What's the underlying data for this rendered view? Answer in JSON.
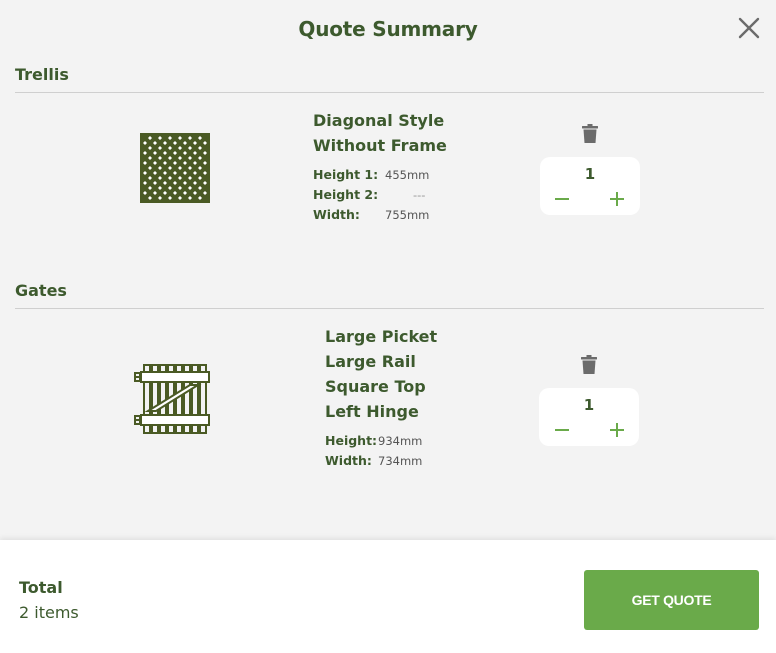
{
  "header": {
    "title": "Quote Summary",
    "close_icon": "close-icon"
  },
  "sections": [
    {
      "heading": "Trellis",
      "item": {
        "icon": "trellis-lattice-icon",
        "name_lines": [
          "Diagonal Style",
          "Without Frame"
        ],
        "specs": [
          {
            "label": "Height 1:",
            "value": "455mm"
          },
          {
            "label": "Height 2:",
            "value": "---"
          },
          {
            "label": "Width:",
            "value": "755mm"
          }
        ],
        "quantity": "1"
      }
    },
    {
      "heading": "Gates",
      "item": {
        "icon": "gate-icon",
        "name_lines": [
          "Large Picket",
          "Large Rail",
          "Square Top",
          "Left Hinge"
        ],
        "specs": [
          {
            "label": "Height:",
            "value": "934mm"
          },
          {
            "label": "Width:",
            "value": "734mm"
          }
        ],
        "quantity": "1"
      }
    }
  ],
  "footer": {
    "total_label": "Total",
    "total_count": "2 items",
    "cta_label": "GET QUOTE"
  },
  "colors": {
    "text_dark_green": "#3d5a2e",
    "icon_olive": "#4a5a24",
    "plus_minus_green": "#6aaa4a",
    "cta_green": "#6aaa4a",
    "background": "#f3f3f3",
    "trash_gray": "#6b6b6b"
  }
}
